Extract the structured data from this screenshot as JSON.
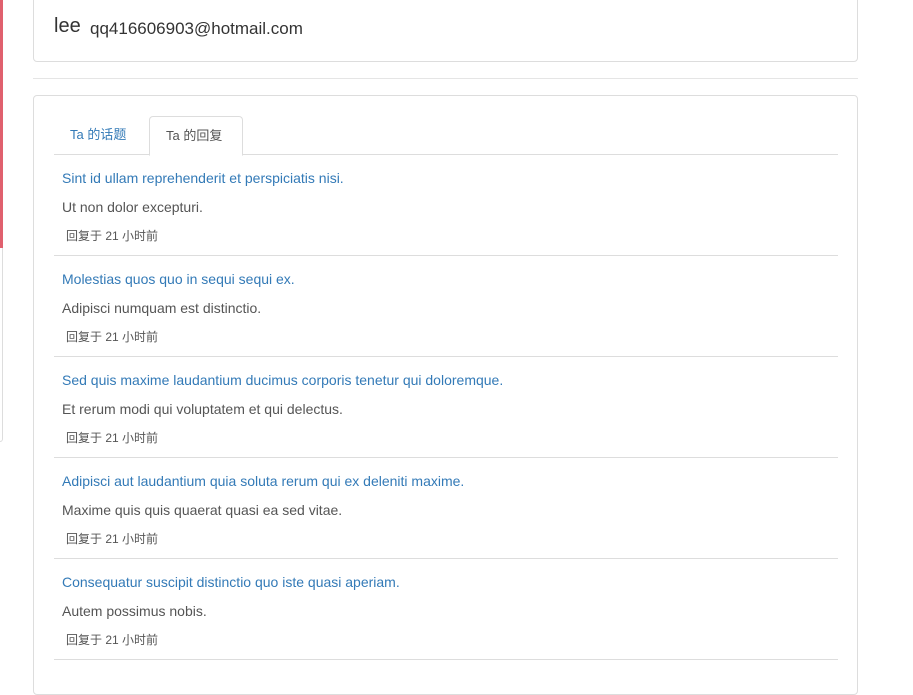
{
  "user": {
    "name": "lee",
    "email": "qq416606903@hotmail.com"
  },
  "tabs": [
    {
      "label": "Ta 的话题"
    },
    {
      "label": "Ta 的回复"
    }
  ],
  "replies": [
    {
      "title": "Sint id ullam reprehenderit et perspiciatis nisi.",
      "body": "Ut non dolor excepturi.",
      "meta": "回复于 21 小时前"
    },
    {
      "title": "Molestias quos quo in sequi sequi ex.",
      "body": "Adipisci numquam est distinctio.",
      "meta": "回复于 21 小时前"
    },
    {
      "title": "Sed quis maxime laudantium ducimus corporis tenetur qui doloremque.",
      "body": "Et rerum modi qui voluptatem et qui delectus.",
      "meta": "回复于 21 小时前"
    },
    {
      "title": "Adipisci aut laudantium quia soluta rerum qui ex deleniti maxime.",
      "body": "Maxime quis quis quaerat quasi ea sed vitae.",
      "meta": "回复于 21 小时前"
    },
    {
      "title": "Consequatur suscipit distinctio quo iste quasi aperiam.",
      "body": "Autem possimus nobis.",
      "meta": "回复于 21 小时前"
    }
  ],
  "colors": {
    "link": "#337ab7",
    "border": "#dddddd",
    "text": "#333333",
    "muted": "#555555",
    "accent": "#e0606e"
  }
}
